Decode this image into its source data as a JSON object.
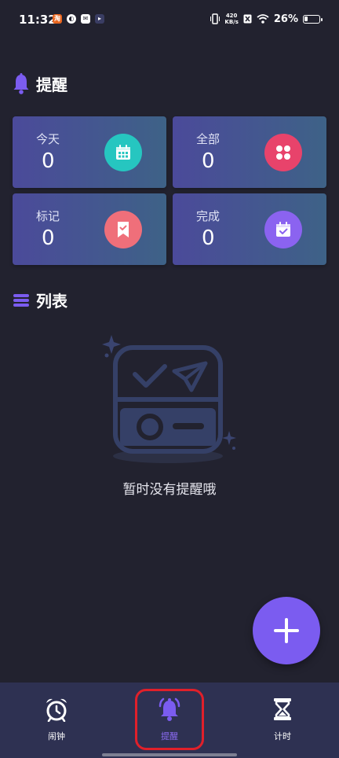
{
  "status_bar": {
    "time": "11:32",
    "network_speed_top": "420",
    "network_speed_bottom": "KB/s",
    "battery_text": "26%",
    "battery_level": 0.26
  },
  "header": {
    "title": "提醒",
    "icon": "bell-icon"
  },
  "cards": [
    {
      "label": "今天",
      "count": "0",
      "icon": "calendar-icon",
      "icon_color": "#26c6c0"
    },
    {
      "label": "全部",
      "count": "0",
      "icon": "grid-flower-icon",
      "icon_color": "#e8436b"
    },
    {
      "label": "标记",
      "count": "0",
      "icon": "bookmark-check-icon",
      "icon_color": "#ef6f7a"
    },
    {
      "label": "完成",
      "count": "0",
      "icon": "calendar-check-icon",
      "icon_color": "#8b63f0"
    }
  ],
  "list_section": {
    "title": "列表",
    "icon": "list-icon"
  },
  "empty_state": {
    "message": "暂时没有提醒哦",
    "icon": "empty-box-illustration"
  },
  "fab": {
    "icon": "plus-icon"
  },
  "bottom_nav": {
    "items": [
      {
        "label": "闹钟",
        "icon": "alarm-clock-icon",
        "active": false
      },
      {
        "label": "提醒",
        "icon": "bell-icon",
        "active": true
      },
      {
        "label": "计时",
        "icon": "hourglass-icon",
        "active": false
      }
    ]
  },
  "colors": {
    "background": "#22222f",
    "accent": "#7b5cf0",
    "nav_background": "#2e3152",
    "highlight": "#e0202a"
  }
}
